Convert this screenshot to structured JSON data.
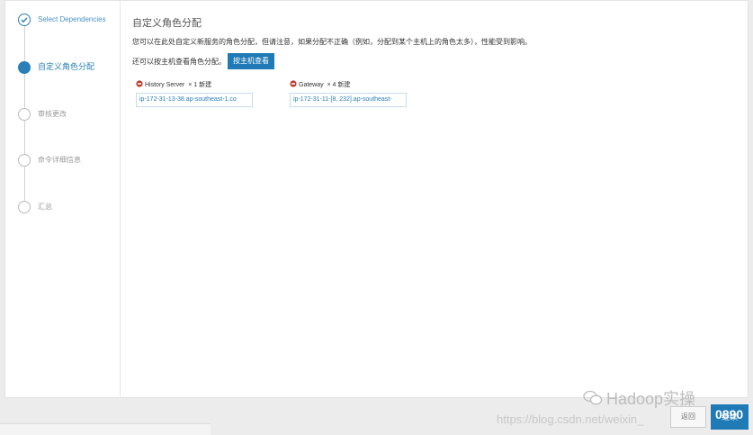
{
  "steps": [
    {
      "label": "Select Dependencies",
      "state": "done"
    },
    {
      "label": "自定义角色分配",
      "state": "active"
    },
    {
      "label": "审核更改",
      "state": "pending"
    },
    {
      "label": "命令详细信息",
      "state": "pending"
    },
    {
      "label": "汇总",
      "state": "pending"
    }
  ],
  "main": {
    "title": "自定义角色分配",
    "description": "您可以在此处自定义新服务的角色分配，但请注意，如果分配不正确（例如，分配到某个主机上的角色太多），性能受到影响。",
    "host_view_prompt": "还可以按主机查看角色分配。",
    "host_view_button": "按主机查看"
  },
  "roles": [
    {
      "name": "History Server",
      "count": "× 1 新建",
      "hosts": "ip-172-31-13-38.ap-southeast-1.co"
    },
    {
      "name": "Gateway",
      "count": "× 4 新建",
      "hosts": "ip-172-31-11-[8, 232].ap-southeast-"
    }
  ],
  "footer": {
    "back_label": "返回",
    "next_label": "继续",
    "watermark": "https://blog.csdn.net/weixin_",
    "wechat": "Hadoop实操",
    "page_number": "0890"
  },
  "colors": {
    "accent": "#1f7ab5",
    "icon_red": "#c0392b"
  }
}
